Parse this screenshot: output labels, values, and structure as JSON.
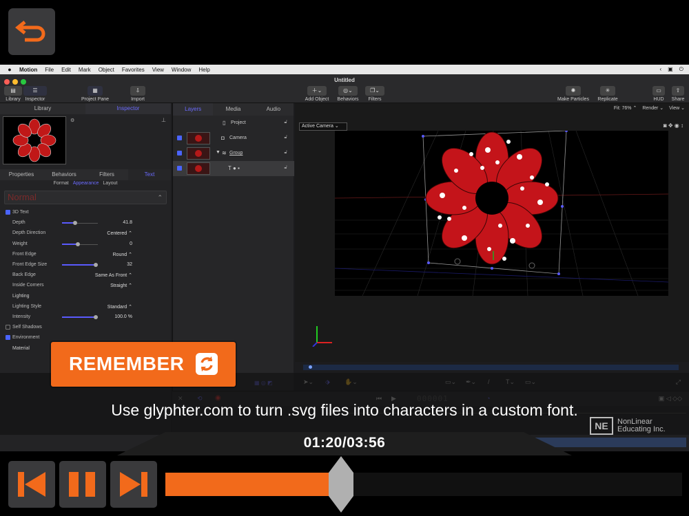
{
  "menubar": {
    "items": [
      "Motion",
      "File",
      "Edit",
      "Mark",
      "Object",
      "Favorites",
      "View",
      "Window",
      "Help"
    ]
  },
  "window": {
    "title": "Untitled"
  },
  "toolbar": {
    "library": "Library",
    "inspector": "Inspector",
    "project_pane": "Project Pane",
    "import": "Import",
    "add_object": "Add Object",
    "behaviors": "Behaviors",
    "filters": "Filters",
    "make_particles": "Make Particles",
    "replicate": "Replicate",
    "hud": "HUD",
    "share": "Share"
  },
  "left_panel": {
    "tabs": [
      "Library",
      "Inspector"
    ],
    "active_tab": "Inspector",
    "subtabs": [
      "Properties",
      "Behaviors",
      "Filters",
      "Text"
    ],
    "active_subtab": "Text",
    "subsubtabs": [
      "Format",
      "Appearance",
      "Layout"
    ],
    "active_subsubtab": "Appearance",
    "style_preset": "Normal",
    "props": [
      {
        "label": "3D Text",
        "type": "check",
        "checked": true
      },
      {
        "label": "Depth",
        "value": "41.8",
        "slider": 0.36
      },
      {
        "label": "Depth Direction",
        "value": "Centered ⌃"
      },
      {
        "label": "Weight",
        "value": "0",
        "slider": 0.45
      },
      {
        "label": "Front Edge",
        "value": "Round ⌃"
      },
      {
        "label": "Front Edge Size",
        "value": "32",
        "slider": 0.95
      },
      {
        "label": "Back Edge",
        "value": "Same As Front ⌃"
      },
      {
        "label": "Inside Corners",
        "value": "Straight ⌃"
      },
      {
        "label": "Lighting",
        "type": "header"
      },
      {
        "label": "Lighting Style",
        "value": "Standard ⌃"
      },
      {
        "label": "Intensity",
        "value": "100.0  %",
        "slider": 0.95
      },
      {
        "label": "Self Shadows",
        "type": "check",
        "checked": false
      },
      {
        "label": "Environment",
        "type": "check",
        "checked": true
      },
      {
        "label": "Material",
        "type": "header"
      }
    ]
  },
  "layers_panel": {
    "tabs": [
      "Layers",
      "Media",
      "Audio"
    ],
    "active_tab": "Layers",
    "rows": [
      {
        "name": "Project"
      },
      {
        "name": "Camera"
      },
      {
        "name": "Group"
      },
      {
        "name": ""
      }
    ]
  },
  "canvas": {
    "fit": "Fit: 76% ⌃",
    "render": "Render ⌄",
    "view": "View ⌄",
    "camera": "Active Camera ⌄"
  },
  "transport": {
    "timecode": "000001"
  },
  "overlay": {
    "remember_label": "REMEMBER",
    "caption": "Use glyphter.com to turn .svg files into characters in a custom font.",
    "logo_mark": "NE",
    "logo_line1": "NonLinear",
    "logo_line2": "Educating Inc."
  },
  "player": {
    "time": "01:20/03:56",
    "progress": 0.34
  },
  "colors": {
    "accent": "#f26a1b",
    "inspector_accent": "#6b6bff"
  }
}
